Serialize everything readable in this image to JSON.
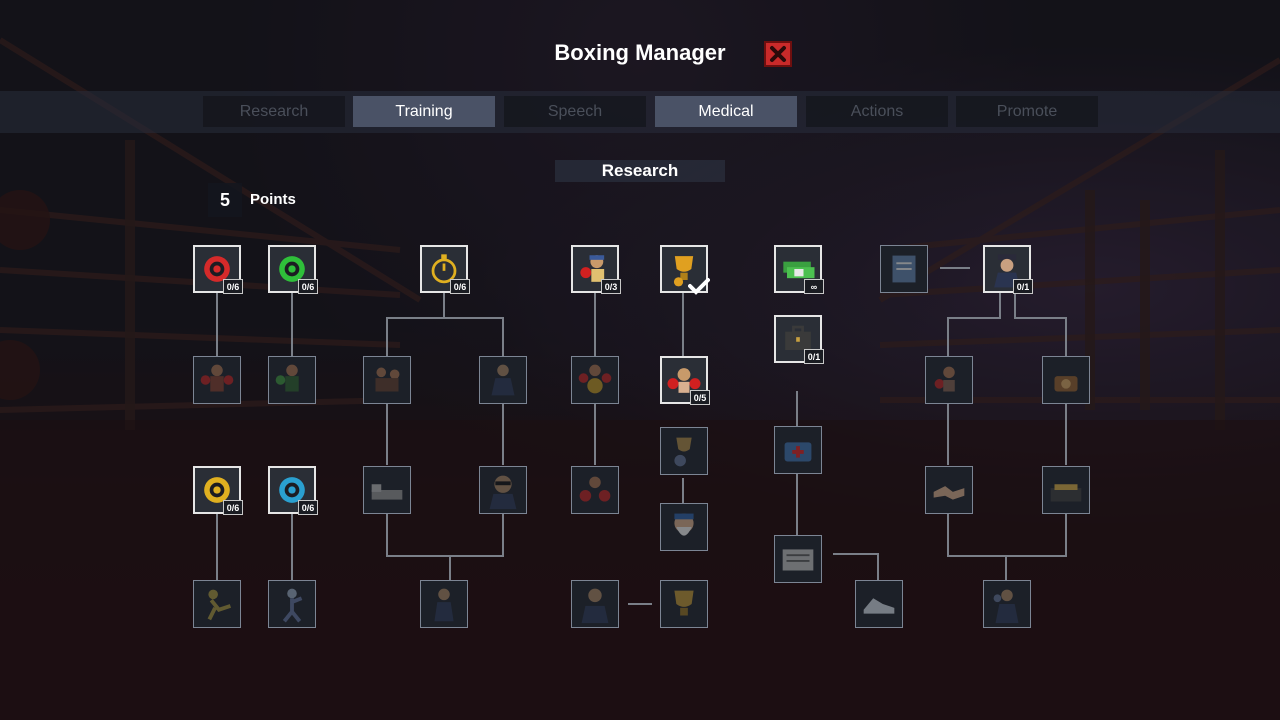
{
  "header": {
    "title": "Boxing Manager"
  },
  "colors": {
    "accent_red": "#c92a2a",
    "tab_active": "#4a5266",
    "tab_inactive_text": "#4a4f5a"
  },
  "tabs": [
    {
      "label": "Research",
      "active": false
    },
    {
      "label": "Training",
      "active": true
    },
    {
      "label": "Speech",
      "active": false
    },
    {
      "label": "Medical",
      "active": true
    },
    {
      "label": "Actions",
      "active": false
    },
    {
      "label": "Promote",
      "active": false
    }
  ],
  "section": {
    "label": "Research"
  },
  "points": {
    "value": "5",
    "label": "Points"
  },
  "nodes": {
    "red_gear": {
      "badge": "0/6",
      "icon": "red-gear-icon"
    },
    "green_gear": {
      "badge": "0/6",
      "icon": "green-gear-icon"
    },
    "stopwatch": {
      "badge": "0/6",
      "icon": "stopwatch-icon"
    },
    "boxer_cap": {
      "badge": "0/3",
      "icon": "boxer-icon"
    },
    "trophy": {
      "badge": "",
      "icon": "trophy-check-icon"
    },
    "money": {
      "badge": "∞",
      "icon": "money-stack-icon"
    },
    "document": {
      "badge": "",
      "icon": "document-icon"
    },
    "manager": {
      "badge": "0/1",
      "icon": "manager-icon"
    },
    "briefcase": {
      "badge": "0/1",
      "icon": "briefcase-icon"
    },
    "boxer_gloves": {
      "badge": "0/5",
      "icon": "boxer-gloves-icon"
    },
    "yellow_gear": {
      "badge": "0/6",
      "icon": "yellow-gear-icon"
    },
    "blue_gear": {
      "badge": "0/6",
      "icon": "blue-gear-icon"
    }
  }
}
